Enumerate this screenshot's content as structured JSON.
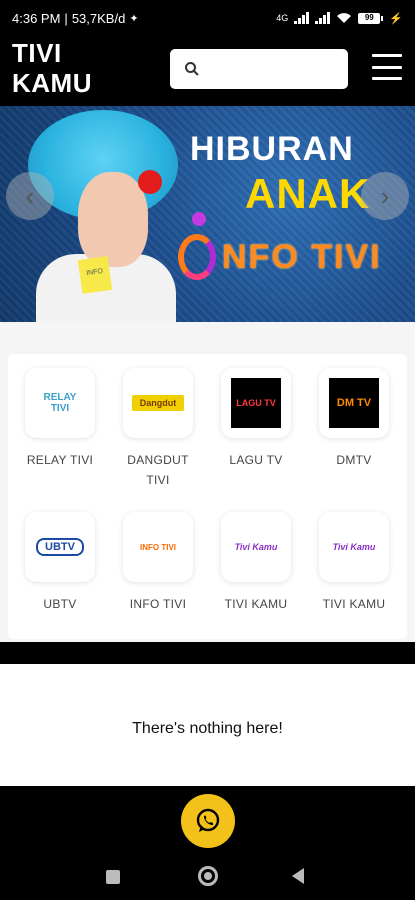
{
  "status_bar": {
    "time": "4:36 PM",
    "network_speed": "53,7KB/d",
    "network_type": "4G",
    "battery": "99"
  },
  "app_bar": {
    "title_line1": "TIVI",
    "title_line2": "KAMU",
    "search_placeholder": "",
    "search_value": ""
  },
  "banner": {
    "line1": "HIBURAN",
    "line2": "ANAK",
    "brand": "NFO TIVI",
    "note_text": "INFO"
  },
  "channels": [
    {
      "label": "RELAY TIVI",
      "logo_text": "RELAY TIVI",
      "label_line2": ""
    },
    {
      "label": "DANGDUT",
      "logo_text": "Dangdut",
      "label_line2": "TIVI"
    },
    {
      "label": "LAGU TV",
      "logo_text": "LAGU TV",
      "label_line2": ""
    },
    {
      "label": "DMTV",
      "logo_text": "DM TV",
      "label_line2": ""
    },
    {
      "label": "UBTV",
      "logo_text": "UBTV",
      "label_line2": ""
    },
    {
      "label": "INFO TIVI",
      "logo_text": "INFO TIVI",
      "label_line2": ""
    },
    {
      "label": "TIVI KAMU",
      "logo_text": "Tivi Kamu",
      "label_line2": ""
    },
    {
      "label": "TIVI KAMU",
      "logo_text": "Tivi Kamu",
      "label_line2": ""
    }
  ],
  "empty_state": {
    "message": "There's nothing here!"
  },
  "icons": {
    "search": "search-icon",
    "menu": "hamburger-menu-icon",
    "whatsapp": "whatsapp-icon"
  },
  "colors": {
    "accent": "#f3c21a",
    "banner_yellow": "#ffd800",
    "banner_orange": "#ff8a1f"
  }
}
